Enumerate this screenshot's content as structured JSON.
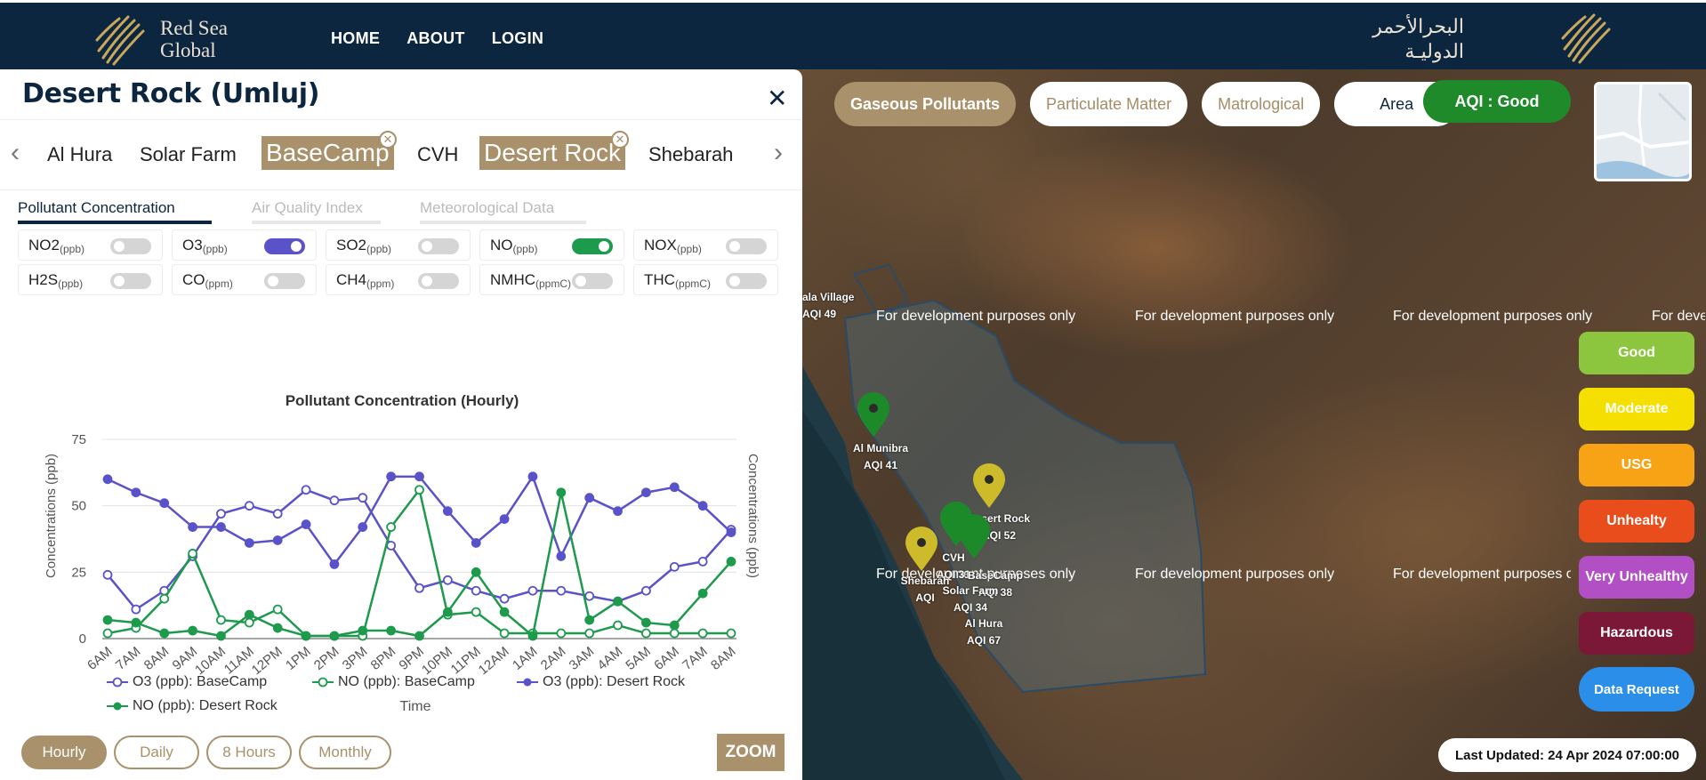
{
  "header": {
    "brand_line1": "Red Sea",
    "brand_line2": "Global",
    "nav": [
      "HOME",
      "ABOUT",
      "LOGIN"
    ],
    "arabic_line1": "البحرالأحمر",
    "arabic_line2": "الدوليـة"
  },
  "map": {
    "pollutant_buttons": [
      "Gaseous Pollutants",
      "Particulate Matter",
      "Matrological",
      "Area"
    ],
    "aqi_badge": "AQI : Good",
    "legend": [
      {
        "label": "Good",
        "color": "#8cc63f"
      },
      {
        "label": "Moderate",
        "color": "#f4df00"
      },
      {
        "label": "USG",
        "color": "#f8a316"
      },
      {
        "label": "Unhealty",
        "color": "#e94d1b"
      },
      {
        "label": "Very Unhealthy",
        "color": "#b34fc4"
      },
      {
        "label": "Hazardous",
        "color": "#7b1737"
      }
    ],
    "data_request": "Data Request",
    "last_updated": "Last Updated: 24 Apr 2024 07:00:00",
    "watermark": "For development purposes only",
    "markers": [
      {
        "name": "Al Munibra",
        "aqi": "AQI 41",
        "color": "#1d8a2a"
      },
      {
        "name": "Desert Rock",
        "aqi": "AQI 52",
        "color": "#cdbb2c"
      },
      {
        "name": "CVH",
        "aqi": "AQI 31",
        "color": "#1d8a2a"
      },
      {
        "name": "BaseCamp",
        "aqi": "AQI 38",
        "color": "#1d8a2a"
      },
      {
        "name": "Solar Farm",
        "aqi": "AQI 34",
        "color": "#1d8a2a"
      },
      {
        "name": "Shebarah",
        "aqi": "AQI",
        "color": "#cdbb2c"
      },
      {
        "name": "Al Hura",
        "aqi": "AQI 67",
        "color": "#cdbb2c"
      },
      {
        "name": "ala Village",
        "aqi": "AQI 49",
        "color": "#1d8a2a"
      }
    ]
  },
  "panel": {
    "title": "Desert Rock (Umluj)",
    "sites": [
      "Al Hura",
      "Solar Farm",
      "BaseCamp",
      "CVH",
      "Desert Rock",
      "Shebarah"
    ],
    "selected_sites": [
      "BaseCamp",
      "Desert Rock"
    ],
    "tabs": [
      "Pollutant Concentration",
      "Air Quality Index",
      "Meteorological Data"
    ],
    "active_tab": "Pollutant Concentration",
    "toggles": [
      {
        "name": "NO2",
        "unit": "(ppb)",
        "state": "off"
      },
      {
        "name": "O3",
        "unit": "(ppb)",
        "state": "on-blue"
      },
      {
        "name": "SO2",
        "unit": "(ppb)",
        "state": "off"
      },
      {
        "name": "NO",
        "unit": "(ppb)",
        "state": "on-green"
      },
      {
        "name": "NOX",
        "unit": "(ppb)",
        "state": "off"
      },
      {
        "name": "H2S",
        "unit": "(ppb)",
        "state": "off"
      },
      {
        "name": "CO",
        "unit": "(ppm)",
        "state": "off"
      },
      {
        "name": "CH4",
        "unit": "(ppm)",
        "state": "off"
      },
      {
        "name": "NMHC",
        "unit": "(ppmC)",
        "state": "off"
      },
      {
        "name": "THC",
        "unit": "(ppmC)",
        "state": "off"
      }
    ],
    "ranges": [
      "Hourly",
      "Daily",
      "8 Hours",
      "Monthly"
    ],
    "active_range": "Hourly",
    "zoom": "ZOOM"
  },
  "chart_data": {
    "type": "line",
    "title": "Pollutant Concentration (Hourly)",
    "xlabel": "Time",
    "ylabel": "Concentrations (ppb)",
    "ylabel_right": "Concentrations (ppb)",
    "ylim": [
      0,
      75
    ],
    "yticks": [
      0,
      25,
      50,
      75
    ],
    "grid": true,
    "legend_position": "bottom",
    "x": [
      "6AM",
      "7AM",
      "8AM",
      "9AM",
      "10AM",
      "11AM",
      "12PM",
      "1PM",
      "2PM",
      "3PM",
      "8PM",
      "9PM",
      "10PM",
      "11PM",
      "12AM",
      "1AM",
      "2AM",
      "3AM",
      "4AM",
      "5AM",
      "6AM",
      "7AM",
      "8AM"
    ],
    "series": [
      {
        "name": "O3 (ppb): BaseCamp",
        "color": "#5a52c8",
        "marker": "hollow",
        "values": [
          24,
          11,
          18,
          31,
          47,
          50,
          47,
          56,
          52,
          53,
          35,
          19,
          22,
          18,
          15,
          18,
          18,
          16,
          14,
          18,
          27,
          29,
          41
        ]
      },
      {
        "name": "NO (ppb): BaseCamp",
        "color": "#1d9a4c",
        "marker": "hollow",
        "values": [
          2,
          4,
          15,
          32,
          7,
          6,
          11,
          1,
          1,
          1,
          42,
          56,
          9,
          10,
          2,
          2,
          2,
          2,
          5,
          2,
          2,
          2,
          2
        ]
      },
      {
        "name": "O3 (ppb): Desert Rock",
        "color": "#5a52c8",
        "marker": "filled",
        "values": [
          60,
          55,
          51,
          42,
          42,
          36,
          37,
          43,
          28,
          42,
          61,
          61,
          48,
          36,
          45,
          61,
          31,
          53,
          48,
          55,
          57,
          50,
          40
        ]
      },
      {
        "name": "NO (ppb): Desert Rock",
        "color": "#1d9a4c",
        "marker": "filled",
        "values": [
          7,
          6,
          2,
          3,
          1,
          9,
          4,
          1,
          1,
          3,
          3,
          1,
          10,
          25,
          10,
          1,
          55,
          7,
          14,
          6,
          5,
          17,
          29
        ]
      }
    ]
  }
}
